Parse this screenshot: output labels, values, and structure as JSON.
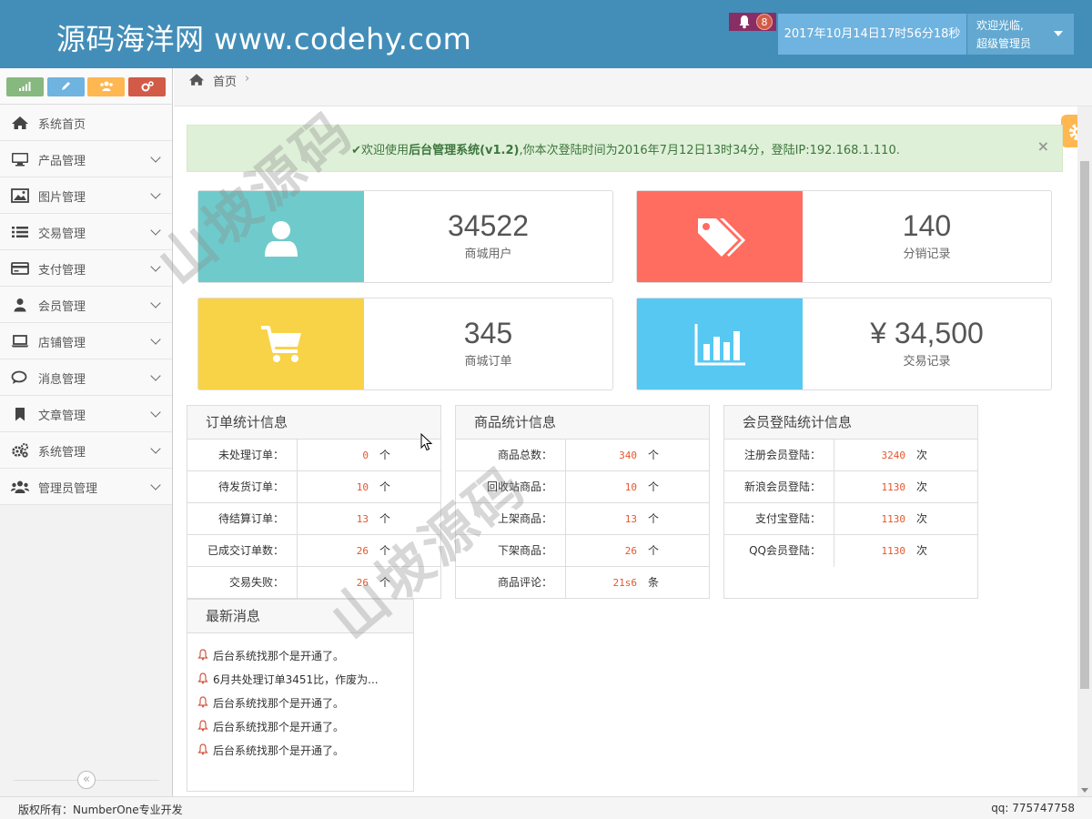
{
  "header": {
    "logo": "源码海洋网  www.codehy.com",
    "notification_count": "8",
    "datetime": "2017年10月14日17时56分18秒",
    "welcome": "欢迎光临,",
    "role": "超级管理员"
  },
  "sidebar": {
    "items": [
      {
        "label": "系统首页",
        "icon": "home-icon"
      },
      {
        "label": "产品管理",
        "icon": "desktop-icon"
      },
      {
        "label": "图片管理",
        "icon": "picture-icon"
      },
      {
        "label": "交易管理",
        "icon": "list-icon"
      },
      {
        "label": "支付管理",
        "icon": "credit-card-icon"
      },
      {
        "label": "会员管理",
        "icon": "user-icon"
      },
      {
        "label": "店铺管理",
        "icon": "laptop-icon"
      },
      {
        "label": "消息管理",
        "icon": "comments-icon"
      },
      {
        "label": "文章管理",
        "icon": "bookmark-icon"
      },
      {
        "label": "系统管理",
        "icon": "cogs-icon"
      },
      {
        "label": "管理员管理",
        "icon": "group-icon"
      }
    ],
    "shortcut_colors": [
      "#87b87f",
      "#6fb3e0",
      "#ffb752",
      "#d15b47"
    ]
  },
  "breadcrumb": {
    "home": "首页"
  },
  "alert": {
    "prefix": "欢迎使用",
    "system_name": "后台管理系统(v1.2)",
    "suffix": ",你本次登陆时间为2016年7月12日13时34分，登陆IP:192.168.1.110.",
    "close": "×"
  },
  "cards": [
    {
      "value": "34522",
      "label": "商城用户",
      "color": "#6fcbcb",
      "icon": "user-icon"
    },
    {
      "value": "140",
      "label": "分销记录",
      "color": "#ff6c60",
      "icon": "tags-icon"
    },
    {
      "value": "345",
      "label": "商城订单",
      "color": "#f8d347",
      "icon": "cart-icon"
    },
    {
      "value": "¥ 34,500",
      "label": "交易记录",
      "color": "#57c8f2",
      "icon": "bar-chart-icon"
    }
  ],
  "order_stats": {
    "title": "订单统计信息",
    "rows": [
      {
        "key": "未处理订单：",
        "value": "0",
        "unit": "个"
      },
      {
        "key": "待发货订单：",
        "value": "10",
        "unit": "个"
      },
      {
        "key": "待结算订单：",
        "value": "13",
        "unit": "个"
      },
      {
        "key": "已成交订单数：",
        "value": "26",
        "unit": "个"
      },
      {
        "key": "交易失败：",
        "value": "26",
        "unit": "个"
      }
    ]
  },
  "product_stats": {
    "title": "商品统计信息",
    "rows": [
      {
        "key": "商品总数：",
        "value": "340",
        "unit": "个"
      },
      {
        "key": "回收站商品：",
        "value": "10",
        "unit": "个"
      },
      {
        "key": "上架商品：",
        "value": "13",
        "unit": "个"
      },
      {
        "key": "下架商品：",
        "value": "26",
        "unit": "个"
      },
      {
        "key": "商品评论：",
        "value": "21s6",
        "unit": "条"
      }
    ]
  },
  "member_stats": {
    "title": "会员登陆统计信息",
    "rows": [
      {
        "key": "注册会员登陆：",
        "value": "3240",
        "unit": "次"
      },
      {
        "key": "新浪会员登陆：",
        "value": "1130",
        "unit": "次"
      },
      {
        "key": "支付宝登陆：",
        "value": "1130",
        "unit": "次"
      },
      {
        "key": "QQ会员登陆：",
        "value": "1130",
        "unit": "次"
      }
    ]
  },
  "news": {
    "title": "最新消息",
    "items": [
      "后台系统找那个是开通了。",
      "6月共处理订单3451比，作废为...",
      "后台系统找那个是开通了。",
      "后台系统找那个是开通了。",
      "后台系统找那个是开通了。"
    ]
  },
  "watermark": "山坡源码",
  "footer": {
    "copyright": "版权所有：NumberOne专业开发",
    "qq": "qq: 775747758"
  }
}
